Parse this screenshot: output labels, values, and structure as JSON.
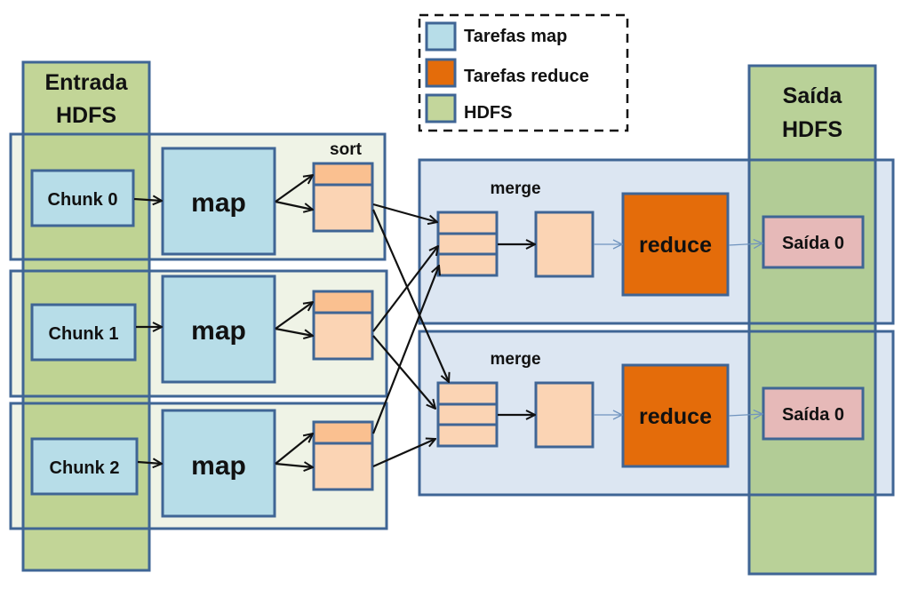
{
  "legend": {
    "items": [
      {
        "label": "Tarefas map",
        "color": "#B7DDE8"
      },
      {
        "label": "Tarefas reduce",
        "color": "#E46C0A"
      },
      {
        "label": "HDFS",
        "color": "#C3D69B"
      }
    ]
  },
  "input_hdfs": {
    "title_line1": "Entrada",
    "title_line2": "HDFS"
  },
  "output_hdfs": {
    "title_line1": "Saída",
    "title_line2": "HDFS"
  },
  "map_rows": [
    {
      "chunk": "Chunk 0",
      "task": "map",
      "buffer_label": "sort"
    },
    {
      "chunk": "Chunk 1",
      "task": "map",
      "buffer_label": ""
    },
    {
      "chunk": "Chunk 2",
      "task": "map",
      "buffer_label": ""
    }
  ],
  "reduce_rows": [
    {
      "merge_label": "merge",
      "task": "reduce",
      "output": "Saída 0"
    },
    {
      "merge_label": "merge",
      "task": "reduce",
      "output": "Saída 0"
    }
  ],
  "colors": {
    "border": "#3F6595",
    "map_fill": "#B7DDE8",
    "reduce_fill": "#E46C0A",
    "hdfs_fill": "#C3D69B",
    "hdfs_overlap_fill": "#A6C08E",
    "map_row_bg": "#EFF3E6",
    "reduce_row_bg": "#DCE6F2",
    "buffer_fill": "#FBD4B4",
    "buffer_top_fill": "#FAC090",
    "output_fill": "#E6B9B8",
    "arrow": "#111111",
    "thin_arrow": "#6F93BE"
  }
}
